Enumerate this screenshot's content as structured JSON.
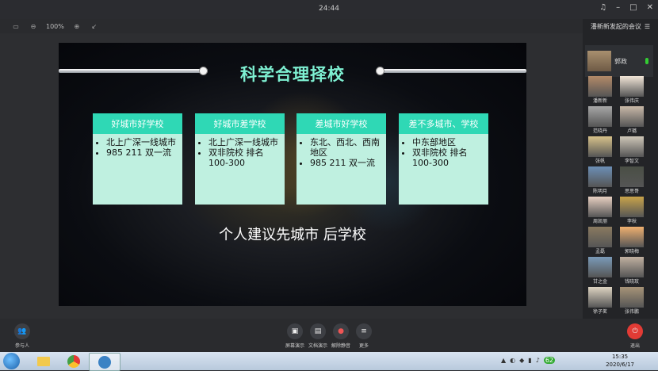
{
  "titlebar": {
    "time": "24:44"
  },
  "toolbar": {
    "zoom": "100%"
  },
  "slide": {
    "title": "科学合理择校",
    "cards": [
      {
        "header": "好城市好学校",
        "items": [
          "北上广深一线城市",
          "985 211 双一流"
        ]
      },
      {
        "header": "好城市差学校",
        "items": [
          "北上广深一线城市",
          "双非院校 排名100-300"
        ]
      },
      {
        "header": "差城市好学校",
        "items": [
          "东北、西北、西南地区",
          "985 211 双一流"
        ]
      },
      {
        "header": "差不多城市、学校",
        "items": [
          "中东部地区",
          "双非院校 排名100-300"
        ]
      }
    ],
    "footer": "个人建议先城市 后学校"
  },
  "sidebar": {
    "title": "潘新新发起的会议",
    "me": "郭政",
    "participants": [
      "潘新新",
      "张伟庆",
      "范晓丹",
      "卢璐",
      "张帆",
      "李智文",
      "陈明月",
      "思思哥",
      "周凯丽",
      "李秋",
      "孟磊",
      "郭晓梅",
      "甘之金",
      "钱晓玫",
      "徐子茗",
      "张伟鹏"
    ]
  },
  "controls": {
    "participants": "参与人",
    "share": "屏幕演示",
    "doc": "文档演示",
    "mute": "解除静音",
    "more": "更多",
    "end": "退出"
  },
  "taskbar": {
    "time": "15:35",
    "date": "2020/6/17",
    "badge": "62"
  },
  "colors": {
    "accent": "#2fd8b5",
    "card_bg": "#bff0e0",
    "title": "#7ef0d2",
    "end": "#e23b35"
  }
}
